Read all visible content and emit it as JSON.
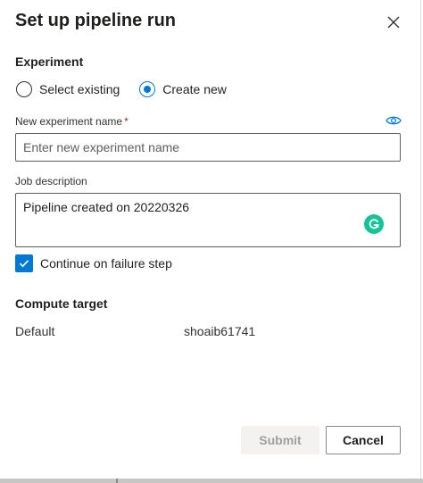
{
  "dialog": {
    "title": "Set up pipeline run"
  },
  "experiment": {
    "heading": "Experiment",
    "options": [
      {
        "label": "Select existing",
        "checked": false
      },
      {
        "label": "Create new",
        "checked": true
      }
    ],
    "name_label": "New experiment name",
    "required_marker": "*",
    "name_placeholder": "Enter new experiment name",
    "name_value": "",
    "visibility_icon": "eye-icon"
  },
  "job": {
    "description_label": "Job description",
    "description_value": "Pipeline created on 20220326",
    "assistant_icon": "grammarly-icon"
  },
  "options": {
    "continue_on_failure_label": "Continue on failure step",
    "continue_on_failure_checked": true
  },
  "compute": {
    "heading": "Compute target",
    "key": "Default",
    "value": "shoaib61741"
  },
  "footer": {
    "submit_label": "Submit",
    "submit_enabled": false,
    "cancel_label": "Cancel"
  },
  "colors": {
    "accent": "#0078d4",
    "required": "#a4262c",
    "grammarly": "#15c39a"
  }
}
